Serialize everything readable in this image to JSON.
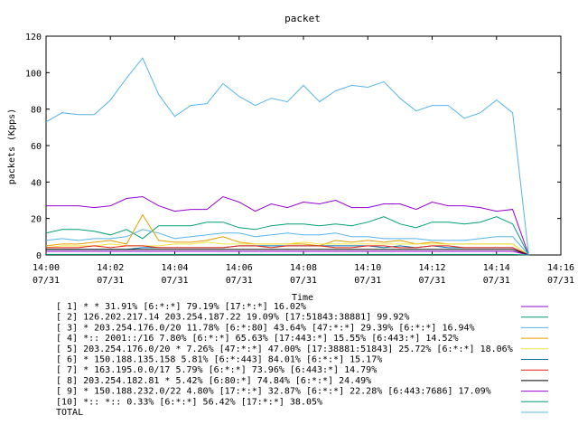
{
  "chart_data": {
    "type": "line",
    "title": "packet",
    "xlabel": "Time",
    "ylabel": "packets (Kpps)",
    "ylim": [
      0,
      120
    ],
    "yticks": [
      0,
      20,
      40,
      60,
      80,
      100,
      120
    ],
    "xlim": [
      "14:00",
      "14:16"
    ],
    "xticks": [
      {
        "time": "14:00",
        "date": "07/31"
      },
      {
        "time": "14:02",
        "date": "07/31"
      },
      {
        "time": "14:04",
        "date": "07/31"
      },
      {
        "time": "14:06",
        "date": "07/31"
      },
      {
        "time": "14:08",
        "date": "07/31"
      },
      {
        "time": "14:10",
        "date": "07/31"
      },
      {
        "time": "14:12",
        "date": "07/31"
      },
      {
        "time": "14:14",
        "date": "07/31"
      },
      {
        "time": "14:16",
        "date": "07/31"
      }
    ],
    "x": [
      "14:00:00",
      "14:00:30",
      "14:01:00",
      "14:01:30",
      "14:02:00",
      "14:02:30",
      "14:03:00",
      "14:03:30",
      "14:04:00",
      "14:04:30",
      "14:05:00",
      "14:05:30",
      "14:06:00",
      "14:06:30",
      "14:07:00",
      "14:07:30",
      "14:08:00",
      "14:08:30",
      "14:09:00",
      "14:09:30",
      "14:10:00",
      "14:10:30",
      "14:11:00",
      "14:11:30",
      "14:12:00",
      "14:12:30",
      "14:13:00",
      "14:13:30",
      "14:14:00",
      "14:14:30",
      "14:15:00"
    ],
    "series": [
      {
        "name": "[ 1] * * 31.91%  [6:*:*] 79.19% [17:*:*] 16.02%",
        "color": "#9400d3",
        "values": [
          27,
          27,
          27,
          26,
          27,
          31,
          32,
          27,
          24,
          25,
          25,
          32,
          29,
          24,
          28,
          26,
          29,
          28,
          30,
          26,
          26,
          28,
          28,
          25,
          29,
          27,
          27,
          26,
          24,
          25,
          0
        ]
      },
      {
        "name": "[ 2] 126.202.217.14 203.254.187.22 19.09%  [17:51843:38881] 99.92%",
        "color": "#009e73",
        "values": [
          12,
          14,
          14,
          13,
          11,
          14,
          9,
          16,
          16,
          16,
          18,
          18,
          15,
          14,
          16,
          17,
          17,
          16,
          17,
          16,
          18,
          21,
          17,
          15,
          18,
          18,
          17,
          18,
          21,
          17,
          0
        ]
      },
      {
        "name": "[ 3] * 203.254.176.0/20 11.78%  [6:*:80] 43.64% [47:*:*] 29.39% [6:*:*] 16.94%",
        "color": "#56b4e9",
        "values": [
          8,
          9,
          8,
          9,
          9,
          10,
          14,
          12,
          9,
          10,
          11,
          12,
          12,
          10,
          11,
          12,
          11,
          11,
          12,
          10,
          10,
          9,
          9,
          9,
          8,
          8,
          8,
          9,
          10,
          10,
          0
        ]
      },
      {
        "name": "[ 4] *:: 2001::/16 7.80%  [6:*:*] 65.63% [17:443:*] 15.55% [6:443:*] 14.52%",
        "color": "#e69f00",
        "values": [
          5,
          6,
          6,
          7,
          8,
          6,
          22,
          8,
          7,
          7,
          8,
          10,
          7,
          6,
          6,
          6,
          6,
          5,
          8,
          7,
          8,
          7,
          8,
          6,
          7,
          6,
          6,
          6,
          6,
          6,
          0
        ]
      },
      {
        "name": "[ 5] 203.254.176.0/20 * 7.26%  [47:*:*] 47.00% [17:38881:51843] 25.72% [6:*:*] 18.06%",
        "color": "#f0e442",
        "values": [
          4,
          5,
          5,
          5,
          6,
          5,
          5,
          5,
          6,
          6,
          7,
          6,
          6,
          6,
          6,
          6,
          7,
          6,
          6,
          6,
          6,
          6,
          6,
          6,
          6,
          6,
          6,
          6,
          6,
          6,
          0
        ]
      },
      {
        "name": "[ 6] * 150.188.135.158 5.81%  [6:*:443] 84.01% [6:*:*] 15.17%",
        "color": "#0072b2",
        "values": [
          3,
          3,
          3,
          3,
          3,
          3,
          4,
          4,
          4,
          4,
          4,
          4,
          5,
          5,
          5,
          5,
          5,
          5,
          5,
          5,
          5,
          4,
          5,
          4,
          5,
          4,
          4,
          4,
          4,
          4,
          0
        ]
      },
      {
        "name": "[ 7] * 163.195.0.0/17 5.79%  [6:*:*] 73.96% [6:443:*] 14.79%",
        "color": "#e51e10",
        "values": [
          4,
          4,
          4,
          5,
          4,
          5,
          5,
          4,
          4,
          4,
          4,
          4,
          5,
          5,
          4,
          5,
          5,
          5,
          4,
          4,
          5,
          5,
          4,
          4,
          5,
          5,
          4,
          4,
          4,
          4,
          0
        ]
      },
      {
        "name": "[ 8] 203.254.182.81 * 5.42%  [6:80:*] 74.84% [6:*:*] 24.49%",
        "color": "#000000",
        "values": [
          3,
          3,
          3,
          3,
          3,
          3,
          3,
          3,
          3,
          3,
          3,
          3,
          3,
          3,
          3,
          3,
          3,
          3,
          3,
          3,
          3,
          3,
          3,
          3,
          3,
          3,
          3,
          3,
          3,
          3,
          0
        ]
      },
      {
        "name": "[ 9] * 150.188.232.0/22 4.80%  [17:*:*] 32.87% [6:*:*] 22.28% [6:443:7686] 17.09%",
        "color": "#9400d3",
        "values": [
          2,
          2,
          2,
          2,
          2,
          2,
          2,
          2,
          2,
          2,
          2,
          2,
          2,
          2,
          2,
          2,
          2,
          2,
          2,
          2,
          2,
          2,
          2,
          2,
          2,
          2,
          2,
          2,
          2,
          2,
          0
        ]
      },
      {
        "name": "[10] *:: *:: 0.33%  [6:*:*] 56.42% [17:*:*] 38.05%",
        "color": "#009e73",
        "values": [
          0.3,
          0.3,
          0.3,
          0.3,
          0.3,
          0.3,
          0.3,
          0.3,
          0.3,
          0.3,
          0.3,
          0.3,
          0.3,
          0.3,
          0.3,
          0.3,
          0.3,
          0.3,
          0.3,
          0.3,
          0.3,
          0.3,
          0.3,
          0.3,
          0.3,
          0.3,
          0.3,
          0.3,
          0.3,
          0.3,
          0
        ]
      },
      {
        "name": "TOTAL",
        "color": "#56b4e9",
        "values": [
          73,
          78,
          77,
          77,
          85,
          97,
          108,
          88,
          76,
          82,
          83,
          94,
          87,
          82,
          86,
          84,
          93,
          84,
          90,
          93,
          92,
          95,
          86,
          79,
          82,
          82,
          75,
          78,
          85,
          78,
          0
        ]
      }
    ],
    "grid": false,
    "legend": "bottom"
  }
}
